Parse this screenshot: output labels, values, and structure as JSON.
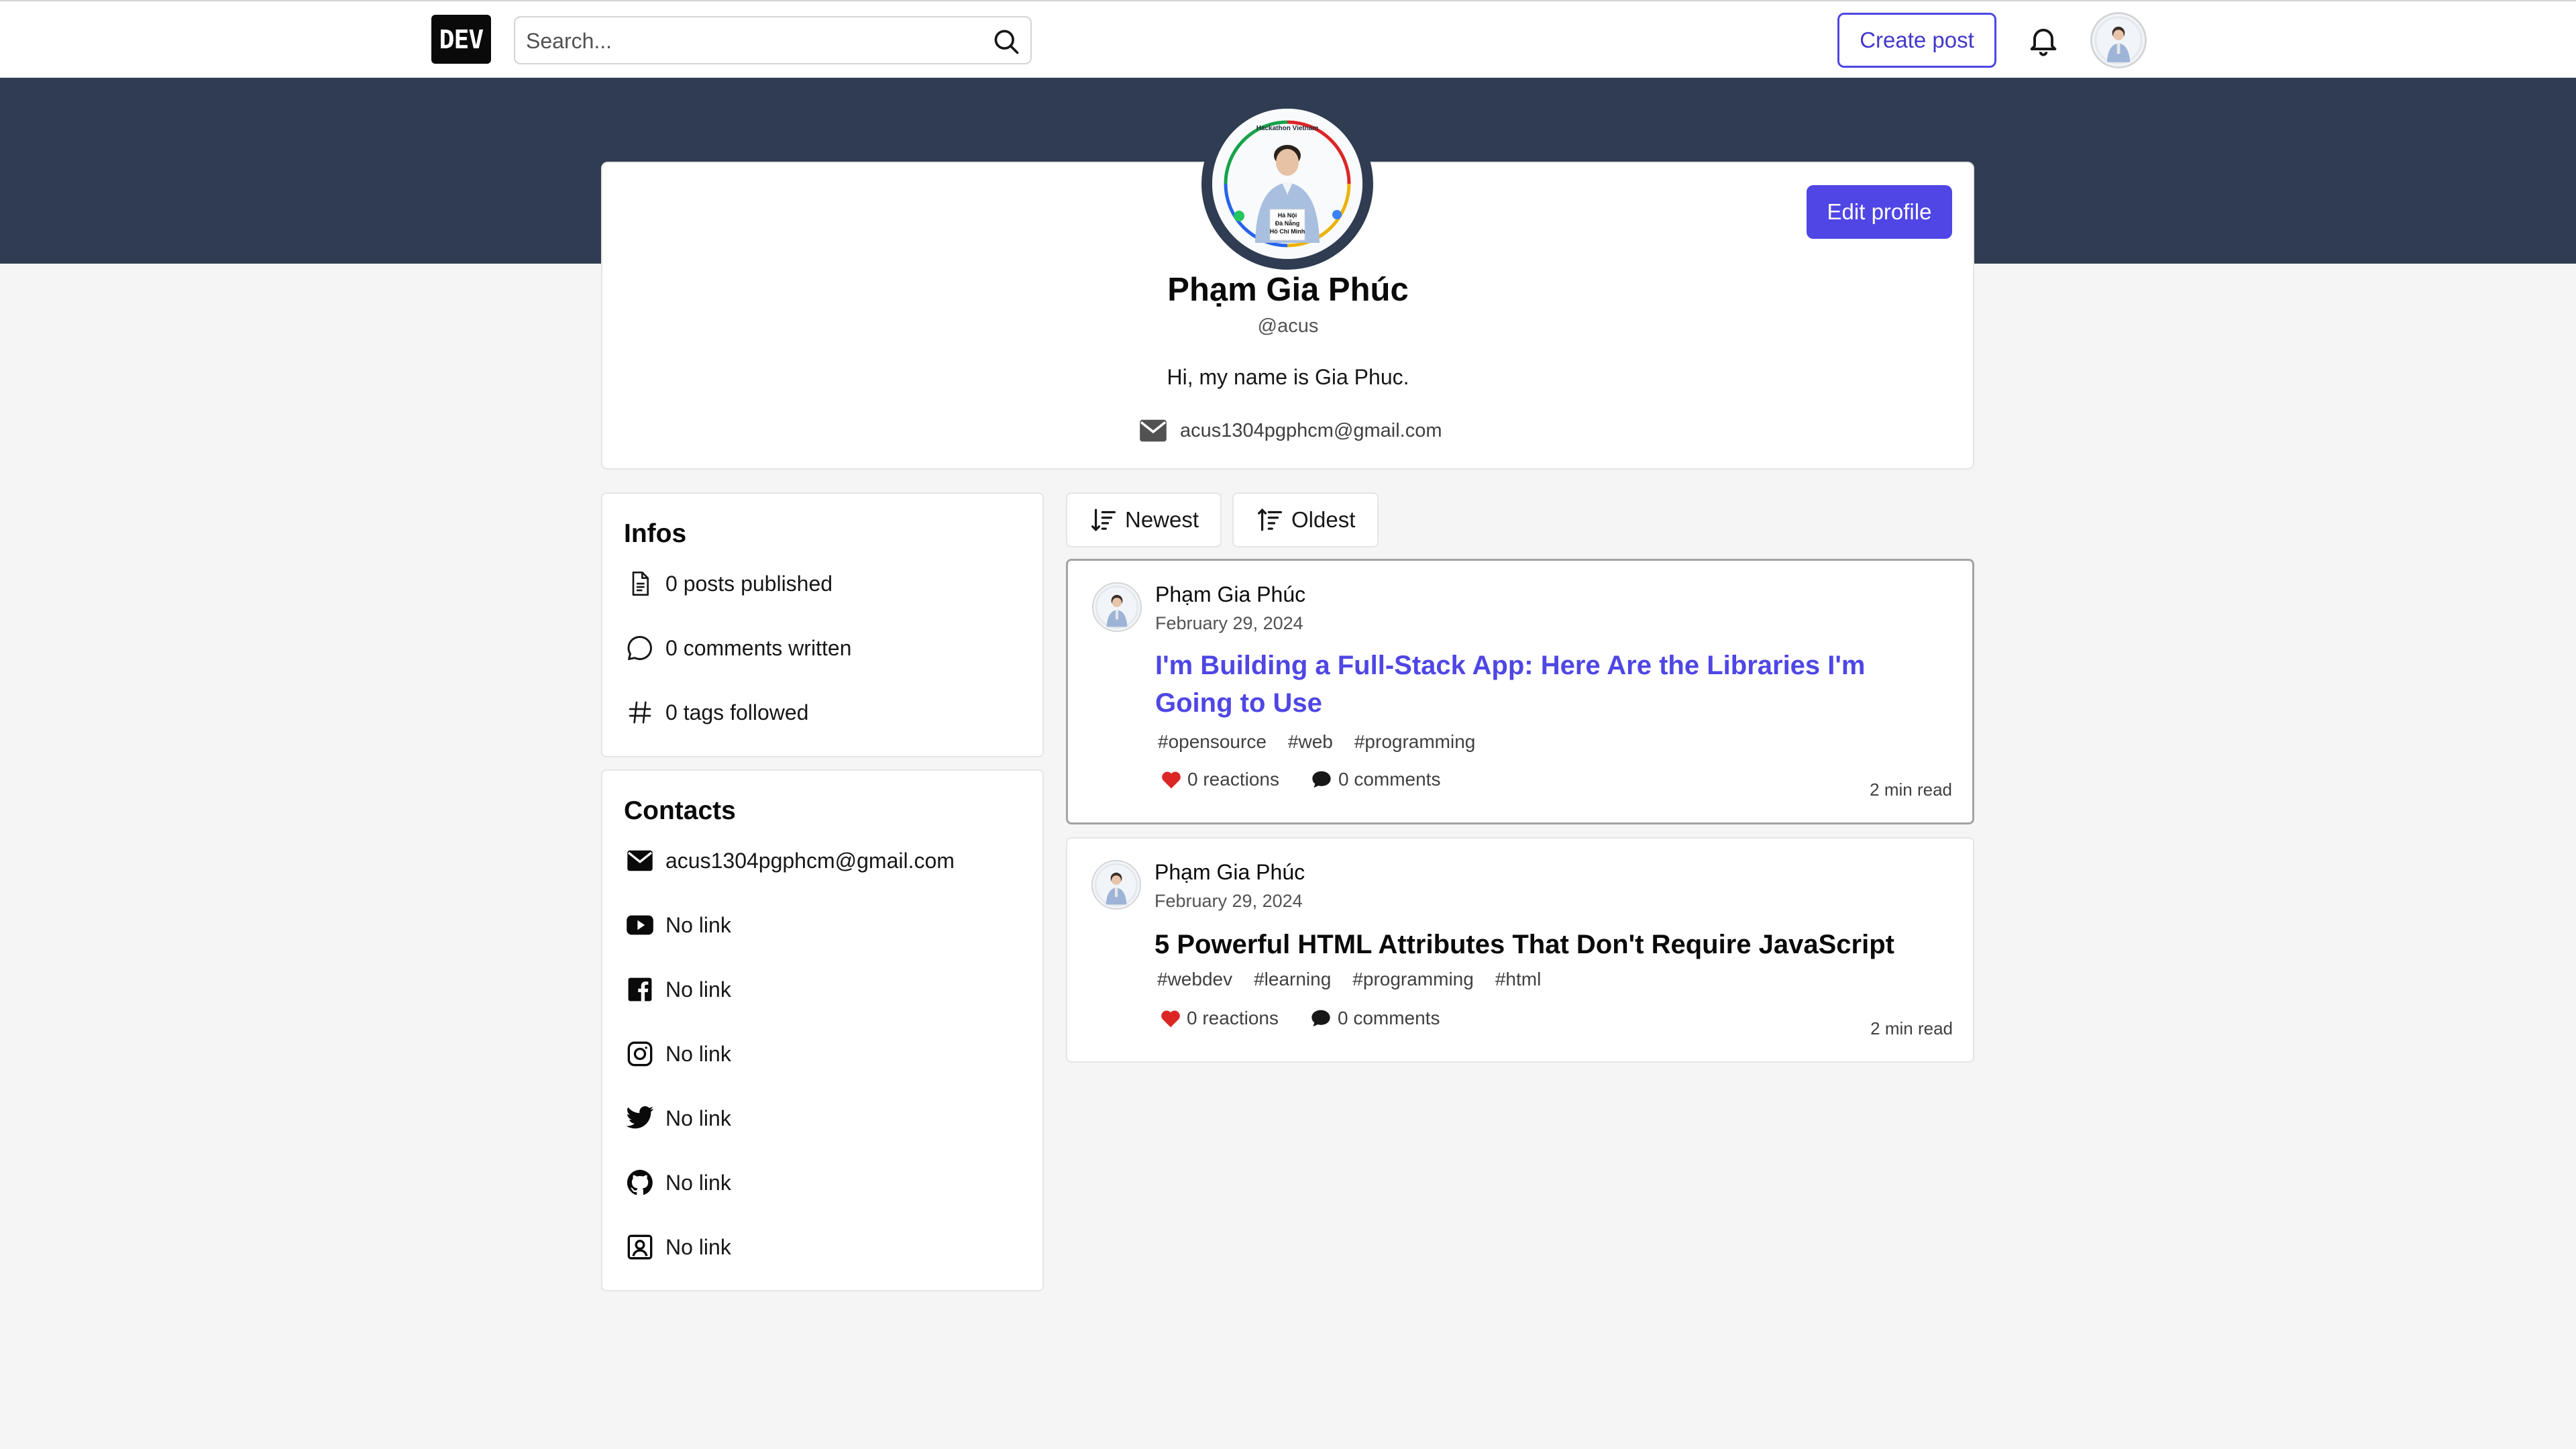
{
  "navbar": {
    "logo_text": "DEV",
    "search_placeholder": "Search...",
    "create_post_label": "Create post"
  },
  "profile": {
    "name": "Phạm Gia Phúc",
    "handle": "@acus",
    "bio": "Hi, my name is Gia Phuc.",
    "email": "acus1304pgphcm@gmail.com",
    "edit_label": "Edit profile",
    "avatar_badge_lines": [
      "Hackathon Vietnam",
      "Hà Nội",
      "Đà Nẵng",
      "Hồ Chí Minh"
    ]
  },
  "infos": {
    "title": "Infos",
    "items": [
      {
        "icon": "document-icon",
        "text": "0 posts published"
      },
      {
        "icon": "comment-icon",
        "text": "0 comments written"
      },
      {
        "icon": "hashtag-icon",
        "text": "0 tags followed"
      }
    ]
  },
  "contacts": {
    "title": "Contacts",
    "items": [
      {
        "icon": "mail-icon",
        "text": "acus1304pgphcm@gmail.com"
      },
      {
        "icon": "youtube-icon",
        "text": "No link"
      },
      {
        "icon": "facebook-icon",
        "text": "No link"
      },
      {
        "icon": "instagram-icon",
        "text": "No link"
      },
      {
        "icon": "twitter-icon",
        "text": "No link"
      },
      {
        "icon": "github-icon",
        "text": "No link"
      },
      {
        "icon": "contact-card-icon",
        "text": "No link"
      }
    ]
  },
  "sort": {
    "newest_label": "Newest",
    "oldest_label": "Oldest"
  },
  "posts": [
    {
      "author": "Phạm Gia Phúc",
      "date": "February 29, 2024",
      "title": "I'm Building a Full-Stack App: Here Are the Libraries I'm Going to Use",
      "tags": [
        "#opensource",
        "#web",
        "#programming"
      ],
      "reactions": "0 reactions",
      "comments": "0 comments",
      "read_time": "2 min read"
    },
    {
      "author": "Phạm Gia Phúc",
      "date": "February 29, 2024",
      "title": "5 Powerful HTML Attributes That Don't Require JavaScript",
      "tags": [
        "#webdev",
        "#learning",
        "#programming",
        "#html"
      ],
      "reactions": "0 reactions",
      "comments": "0 comments",
      "read_time": "2 min read"
    }
  ],
  "colors": {
    "accent": "#4f46e5",
    "banner": "#2f3c52",
    "heart": "#dc2626",
    "background": "#f5f5f5"
  }
}
